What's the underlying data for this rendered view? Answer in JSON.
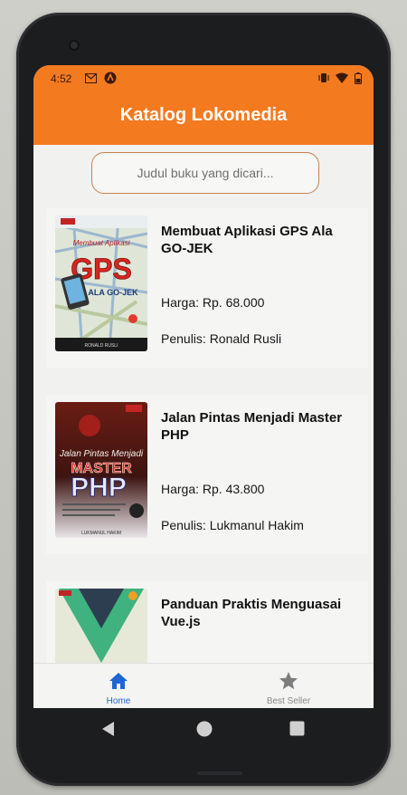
{
  "status": {
    "time": "4:52"
  },
  "app": {
    "title": "Katalog Lokomedia"
  },
  "search": {
    "placeholder": "Judul buku yang dicari..."
  },
  "books": [
    {
      "title": "Membuat Aplikasi GPS Ala GO-JEK",
      "price": "Harga: Rp. 68.000",
      "author": "Penulis: Ronald Rusli",
      "cover": {
        "line1": "Membuat Aplikasi",
        "big": "GPS",
        "sub": "ALA GO-JEK",
        "footer": "RONALD RUSLI"
      }
    },
    {
      "title": "Jalan Pintas Menjadi Master PHP",
      "price": "Harga: Rp. 43.800",
      "author": "Penulis: Lukmanul Hakim",
      "cover": {
        "line1": "Jalan Pintas Menjadi",
        "big": "MASTER",
        "sub": "PHP",
        "footer": "LUKMANUL HAKIM"
      }
    },
    {
      "title": "Panduan Praktis Menguasai Vue.js",
      "price": "",
      "author": "",
      "cover": {
        "line1": "",
        "big": "",
        "sub": "",
        "footer": ""
      }
    }
  ],
  "nav": {
    "home": "Home",
    "best_seller": "Best Seller"
  },
  "colors": {
    "appbar": "#f47a20",
    "accent_active": "#1e66d4",
    "inactive": "#8a8a8a"
  }
}
